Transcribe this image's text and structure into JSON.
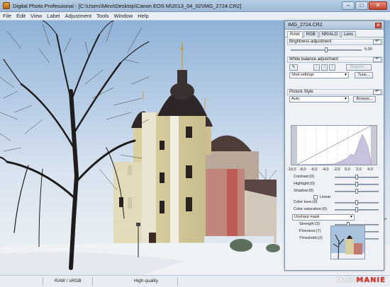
{
  "window": {
    "title": "Digital Photo Professional - [C:\\Users\\Mino\\Desktop\\Canon EOS M\\2013_04_02\\IMG_2724.CR2]",
    "minimize": "–",
    "maximize": "□",
    "close": "✕"
  },
  "menu": [
    "File",
    "Edit",
    "View",
    "Label",
    "Adjustment",
    "Tools",
    "Window",
    "Help"
  ],
  "status": {
    "color_space": "RAW / sRGB",
    "quality": "High quality"
  },
  "watermark": {
    "prefix": "DIGI",
    "highlight": "MANIE"
  },
  "palette": {
    "title": "IMG_2724.CR2",
    "tabs": [
      "RAW",
      "RGB",
      "NR/ALO",
      "Lens"
    ],
    "active_tab": 0,
    "brightness": {
      "header": "Brightness adjustment",
      "value": "0,00",
      "level": 0.5
    },
    "white_balance": {
      "header": "White balance adjustment",
      "buttons": [
        "1",
        "2",
        "3"
      ],
      "register": "Register...",
      "preset": "Shot settings",
      "tune": "Tune..."
    },
    "picture_style": {
      "header": "Picture Style",
      "style": "Auto",
      "browse": "Browse...",
      "axis_ticks": [
        "-10,0",
        "-8,0",
        "-6,0",
        "-4,0",
        "-2,0",
        "0,0",
        "2,0",
        "4,0"
      ]
    },
    "sliders": [
      {
        "label": "Contrast:(0)",
        "level": 0.5
      },
      {
        "label": "Highlight:(0)",
        "level": 0.5
      },
      {
        "label": "Shadow:(0)",
        "level": 0.5
      }
    ],
    "linear_label": "Linear",
    "linear_checked": false,
    "color_sliders": [
      {
        "label": "Color tone:(0)",
        "level": 0.5
      },
      {
        "label": "Color saturation:(0)",
        "level": 0.5
      }
    ],
    "sharpen_mode": "Unsharp mask",
    "unsharp": [
      {
        "label": "Strength:(3)",
        "level": 0.3
      },
      {
        "label": "Fineness:(7)",
        "level": 0.6
      },
      {
        "label": "Threshold:(2)",
        "level": 0.2
      }
    ]
  },
  "colors": {
    "accent": "#aec2d8",
    "close": "#c1442e",
    "panel_bg": "#eef1f5",
    "histogram_fill": "#c9c2dc"
  }
}
